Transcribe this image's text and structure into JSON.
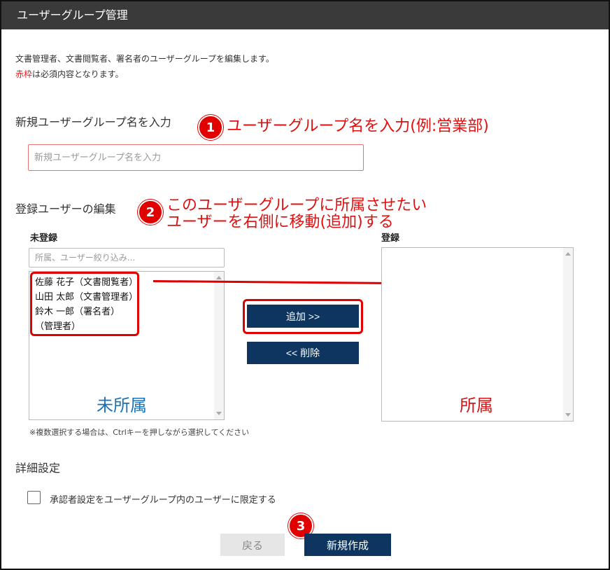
{
  "window": {
    "title": "ユーザーグループ管理"
  },
  "description": {
    "line1": "文書管理者、文書閲覧者、署名者のユーザーグループを編集します。",
    "line2_red": "赤枠",
    "line2_rest": "は必須内容となります。"
  },
  "group_name": {
    "section_title": "新規ユーザーグループ名を入力",
    "placeholder": "新規ユーザーグループ名を入力"
  },
  "members": {
    "section_title": "登録ユーザーの編集",
    "unregistered_label": "未登録",
    "registered_label": "登録",
    "filter_placeholder": "所属、ユーザー絞り込み...",
    "unregistered_users": [
      "佐藤 花子（文書閲覧者）",
      "山田 太郎（文書管理者）",
      "鈴木 一郎（署名者）",
      "（管理者）"
    ],
    "unassigned_caption": "未所属",
    "assigned_caption": "所属",
    "add_button": "追加 >>",
    "remove_button": "<< 削除",
    "multi_select_note": "※複数選択する場合は、Ctrlキーを押しながら選択してください"
  },
  "advanced": {
    "section_title": "詳細設定",
    "checkbox_label": "承認者設定をユーザーグループ内のユーザーに限定する"
  },
  "footer": {
    "back_button": "戻る",
    "create_button": "新規作成"
  },
  "annotations": {
    "step1_number": "1",
    "step1_text": "ユーザーグループ名を入力(例:営業部)",
    "step2_number": "2",
    "step2_line1": "このユーザーグループに所属させたい",
    "step2_line2": "ユーザーを右側に移動(追加)する",
    "step3_number": "3"
  },
  "colors": {
    "titlebar": "#3a3a3a",
    "primary_button": "#0d3560",
    "annotation_red": "#e00000",
    "unassigned_blue": "#1a73b8",
    "assigned_red": "#d01818"
  }
}
